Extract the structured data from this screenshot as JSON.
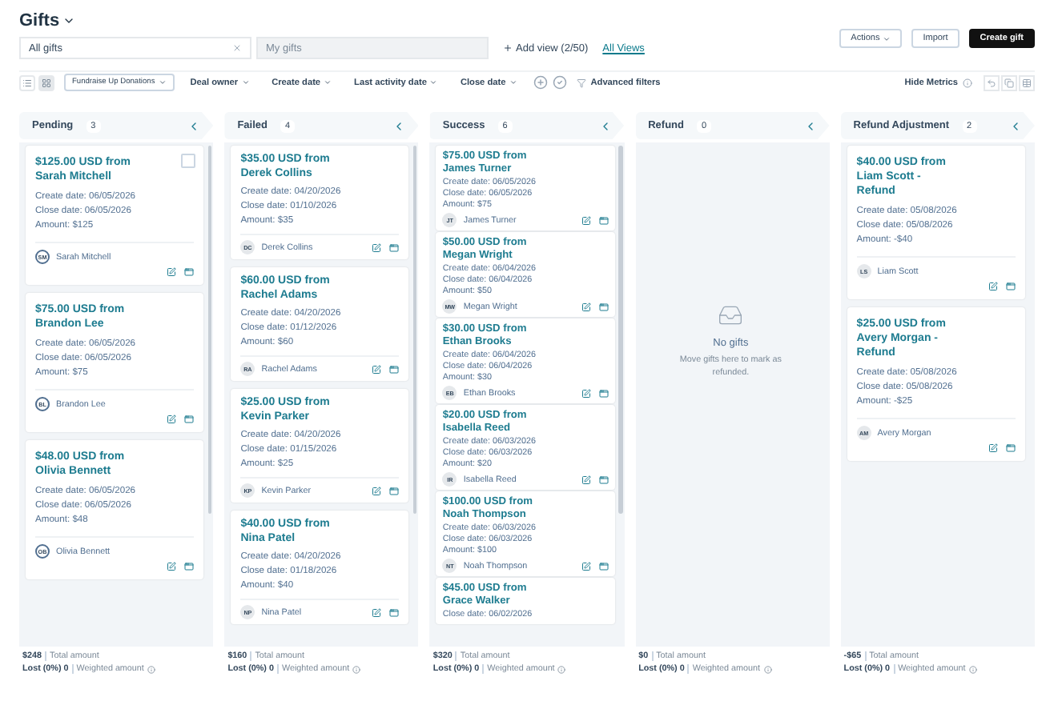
{
  "page_title": "Gifts",
  "views": [
    {
      "label": "All gifts",
      "selected": true,
      "closable": true
    },
    {
      "label": "My gifts",
      "selected": false,
      "closable": false
    }
  ],
  "add_view": "Add view (2/50)",
  "all_views_link": "All Views",
  "actions": [
    {
      "label": "Actions",
      "kind": "menu"
    },
    {
      "label": "Import",
      "kind": "plain"
    },
    {
      "label": "Create gift",
      "kind": "primary"
    }
  ],
  "view_modes": [
    {
      "kind": "list",
      "selected": false
    },
    {
      "kind": "board",
      "selected": true
    }
  ],
  "filters": [
    {
      "label": "Fundraise Up Donations",
      "kind": "boxed"
    },
    {
      "label": "Deal owner",
      "kind": "plain"
    },
    {
      "label": "Create date",
      "kind": "plain"
    },
    {
      "label": "Last activity date",
      "kind": "plain"
    },
    {
      "label": "Close date",
      "kind": "plain"
    }
  ],
  "advanced_filters": "Advanced filters",
  "hide_metrics": "Hide Metrics",
  "columns": [
    {
      "name": "Pending",
      "count": "3",
      "kind": "outlined",
      "scrollbar": true,
      "cards": [
        {
          "title": "$125.00 USD from Sarah Mitchell",
          "create_date": "Create date: 06/05/2026",
          "close_date": "Close date: 06/05/2026",
          "amount": "Amount: $125",
          "initials": "SM",
          "owner": "Sarah Mitchell",
          "checkbox": {
            "checked": false
          }
        },
        {
          "title": "$75.00 USD from Brandon Lee",
          "create_date": "Create date: 06/05/2026",
          "close_date": "Close date: 06/05/2026",
          "amount": "Amount: $75",
          "initials": "BL",
          "owner": "Brandon Lee"
        },
        {
          "title": "$48.00 USD from Olivia Bennett",
          "create_date": "Create date: 06/05/2026",
          "close_date": "Close date: 06/05/2026",
          "amount": "Amount: $48",
          "initials": "OB",
          "owner": "Olivia Bennett"
        }
      ],
      "footer": {
        "total": "$248",
        "total_label": "Total amount",
        "lost": "Lost (0%) 0",
        "weighted_label": "Weighted amount"
      }
    },
    {
      "name": "Failed",
      "count": "4",
      "kind": "standard",
      "scrollbar": true,
      "cards": [
        {
          "title": "$35.00 USD from Derek Collins",
          "create_date": "Create date: 04/20/2026",
          "close_date": "Close date: 01/10/2026",
          "amount": "Amount: $35",
          "initials": "DC",
          "owner": "Derek Collins"
        },
        {
          "title": "$60.00 USD from Rachel Adams",
          "create_date": "Create date: 04/20/2026",
          "close_date": "Close date: 01/12/2026",
          "amount": "Amount: $60",
          "initials": "RA",
          "owner": "Rachel Adams"
        },
        {
          "title": "$25.00 USD from Kevin Parker",
          "create_date": "Create date: 04/20/2026",
          "close_date": "Close date: 01/15/2026",
          "amount": "Amount: $25",
          "initials": "KP",
          "owner": "Kevin Parker"
        },
        {
          "title": "$40.00 USD from Nina Patel",
          "create_date": "Create date: 04/20/2026",
          "close_date": "Close date: 01/18/2026",
          "amount": "Amount: $40",
          "initials": "NP",
          "owner": "Nina Patel"
        }
      ],
      "footer": {
        "total": "$160",
        "total_label": "Total amount",
        "lost": "Lost (0%) 0",
        "weighted_label": "Weighted amount"
      }
    },
    {
      "name": "Success",
      "count": "6",
      "kind": "dense",
      "scrollbar": true,
      "cards": [
        {
          "title": "$75.00 USD from James Turner",
          "create_date": "Create date: 06/05/2026",
          "close_date": "Close date: 06/05/2026",
          "amount": "Amount: $75",
          "initials": "JT",
          "owner": "James Turner"
        },
        {
          "title": "$50.00 USD from Megan Wright",
          "create_date": "Create date: 06/04/2026",
          "close_date": "Close date: 06/04/2026",
          "amount": "Amount: $50",
          "initials": "MW",
          "owner": "Megan Wright"
        },
        {
          "title": "$30.00 USD from Ethan Brooks",
          "create_date": "Create date: 06/04/2026",
          "close_date": "Close date: 06/04/2026",
          "amount": "Amount: $30",
          "initials": "EB",
          "owner": "Ethan Brooks"
        },
        {
          "title": "$20.00 USD from Isabella Reed",
          "create_date": "Create date: 06/03/2026",
          "close_date": "Close date: 06/03/2026",
          "amount": "Amount: $20",
          "initials": "IR",
          "owner": "Isabella Reed"
        },
        {
          "title": "$100.00 USD from Noah Thompson",
          "create_date": "Create date: 06/03/2026",
          "close_date": "Close date: 06/03/2026",
          "amount": "Amount: $100",
          "initials": "NT",
          "owner": "Noah Thompson"
        },
        {
          "title": "$45.00 USD from Grace Walker",
          "close_date": "Close date: 06/02/2026"
        }
      ],
      "footer": {
        "total": "$320",
        "total_label": "Total amount",
        "lost": "Lost (0%) 0",
        "weighted_label": "Weighted amount"
      }
    },
    {
      "name": "Refund",
      "count": "0",
      "kind": "empty",
      "scrollbar": false,
      "empty": {
        "title": "No gifts",
        "hint": "Move gifts here to mark as refunded."
      },
      "footer": {
        "total": "$0",
        "total_label": "Total amount",
        "lost": "Lost (0%) 0",
        "weighted_label": "Weighted amount"
      }
    },
    {
      "name": "Refund Adjustment",
      "count": "2",
      "kind": "roomy",
      "scrollbar": false,
      "cards": [
        {
          "title": "$40.00 USD from Liam Scott - Refund",
          "create_date": "Create date: 05/08/2026",
          "close_date": "Close date: 05/08/2026",
          "amount": "Amount: -$40",
          "initials": "LS",
          "owner": "Liam Scott"
        },
        {
          "title": "$25.00 USD from Avery Morgan - Refund",
          "create_date": "Create date: 05/08/2026",
          "close_date": "Close date: 05/08/2026",
          "amount": "Amount: -$25",
          "initials": "AM",
          "owner": "Avery Morgan"
        }
      ],
      "footer": {
        "total": "-$65",
        "total_label": "Total amount",
        "lost": "Lost (0%) 0",
        "weighted_label": "Weighted amount"
      }
    }
  ]
}
